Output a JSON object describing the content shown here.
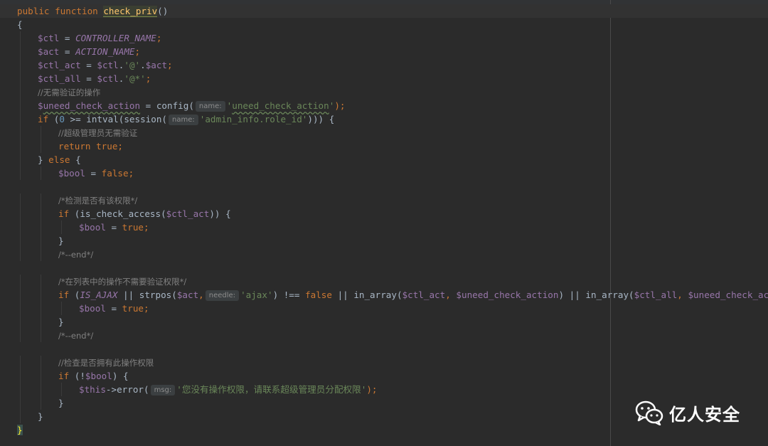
{
  "editor": {
    "lines": [
      {
        "indent": 0,
        "segs": [
          {
            "t": "public function ",
            "c": "kw"
          },
          {
            "t": "check_priv",
            "c": "fn-hl"
          },
          {
            "t": "()",
            "c": "plain"
          }
        ],
        "current": true
      },
      {
        "indent": 0,
        "segs": [
          {
            "t": "{",
            "c": "plain"
          }
        ]
      },
      {
        "indent": 1,
        "segs": [
          {
            "t": "$ctl",
            "c": "var"
          },
          {
            "t": " = ",
            "c": "plain"
          },
          {
            "t": "CONTROLLER_NAME",
            "c": "const"
          },
          {
            "t": ";",
            "c": "kw"
          }
        ]
      },
      {
        "indent": 1,
        "segs": [
          {
            "t": "$act",
            "c": "var"
          },
          {
            "t": " = ",
            "c": "plain"
          },
          {
            "t": "ACTION_NAME",
            "c": "const"
          },
          {
            "t": ";",
            "c": "kw"
          }
        ]
      },
      {
        "indent": 1,
        "segs": [
          {
            "t": "$ctl_act",
            "c": "var"
          },
          {
            "t": " = ",
            "c": "plain"
          },
          {
            "t": "$ctl",
            "c": "var"
          },
          {
            "t": ".",
            "c": "plain"
          },
          {
            "t": "'@'",
            "c": "str"
          },
          {
            "t": ".",
            "c": "plain"
          },
          {
            "t": "$act",
            "c": "var"
          },
          {
            "t": ";",
            "c": "kw"
          }
        ]
      },
      {
        "indent": 1,
        "segs": [
          {
            "t": "$ctl_all",
            "c": "var"
          },
          {
            "t": " = ",
            "c": "plain"
          },
          {
            "t": "$ctl",
            "c": "var"
          },
          {
            "t": ".",
            "c": "plain"
          },
          {
            "t": "'@*'",
            "c": "str"
          },
          {
            "t": ";",
            "c": "kw"
          }
        ]
      },
      {
        "indent": 1,
        "segs": [
          {
            "t": "//无需验证的操作",
            "c": "cmt"
          }
        ]
      },
      {
        "indent": 1,
        "segs": [
          {
            "t": "$",
            "c": "var"
          },
          {
            "t": "uneed_check_action",
            "c": "var wavy"
          },
          {
            "t": " = ",
            "c": "plain"
          },
          {
            "t": "config(",
            "c": "plain"
          },
          {
            "hint": "name:"
          },
          {
            "t": "'",
            "c": "str"
          },
          {
            "t": "uneed_check_action",
            "c": "str wavy"
          },
          {
            "t": "'",
            "c": "str"
          },
          {
            "t": ");",
            "c": "kw"
          }
        ]
      },
      {
        "indent": 1,
        "segs": [
          {
            "t": "if",
            "c": "kw"
          },
          {
            "t": " (",
            "c": "plain"
          },
          {
            "t": "0",
            "c": "num"
          },
          {
            "t": " >= intval(session(",
            "c": "plain"
          },
          {
            "hint": "name:"
          },
          {
            "t": "'admin_info.role_id'",
            "c": "str"
          },
          {
            "t": "))) {",
            "c": "plain"
          }
        ]
      },
      {
        "indent": 2,
        "segs": [
          {
            "t": "//超级管理员无需验证",
            "c": "cmt"
          }
        ]
      },
      {
        "indent": 2,
        "segs": [
          {
            "t": "return true",
            "c": "kw"
          },
          {
            "t": ";",
            "c": "kw"
          }
        ]
      },
      {
        "indent": 1,
        "segs": [
          {
            "t": "} ",
            "c": "plain"
          },
          {
            "t": "else",
            "c": "kw"
          },
          {
            "t": " {",
            "c": "plain"
          }
        ]
      },
      {
        "indent": 2,
        "segs": [
          {
            "t": "$bool",
            "c": "var"
          },
          {
            "t": " = ",
            "c": "plain"
          },
          {
            "t": "false",
            "c": "kw"
          },
          {
            "t": ";",
            "c": "kw"
          }
        ]
      },
      {
        "indent": 0,
        "segs": []
      },
      {
        "indent": 2,
        "segs": [
          {
            "t": "/*检测是否有该权限*/",
            "c": "cmt"
          }
        ]
      },
      {
        "indent": 2,
        "segs": [
          {
            "t": "if",
            "c": "kw"
          },
          {
            "t": " (is_check_access(",
            "c": "plain"
          },
          {
            "t": "$ctl_act",
            "c": "var"
          },
          {
            "t": ")) {",
            "c": "plain"
          }
        ]
      },
      {
        "indent": 3,
        "segs": [
          {
            "t": "$bool",
            "c": "var"
          },
          {
            "t": " = ",
            "c": "plain"
          },
          {
            "t": "true",
            "c": "kw"
          },
          {
            "t": ";",
            "c": "kw"
          }
        ]
      },
      {
        "indent": 2,
        "segs": [
          {
            "t": "}",
            "c": "plain"
          }
        ]
      },
      {
        "indent": 2,
        "segs": [
          {
            "t": "/*--end*/",
            "c": "cmt"
          }
        ]
      },
      {
        "indent": 0,
        "segs": []
      },
      {
        "indent": 2,
        "segs": [
          {
            "t": "/*在列表中的操作不需要验证权限*/",
            "c": "cmt"
          }
        ]
      },
      {
        "indent": 2,
        "segs": [
          {
            "t": "if",
            "c": "kw"
          },
          {
            "t": " (",
            "c": "plain"
          },
          {
            "t": "IS_AJAX",
            "c": "const"
          },
          {
            "t": " || strpos(",
            "c": "plain"
          },
          {
            "t": "$act",
            "c": "var"
          },
          {
            "t": ",",
            "c": "kw"
          },
          {
            "hint": "needle:"
          },
          {
            "t": "'ajax'",
            "c": "str"
          },
          {
            "t": ") !== ",
            "c": "plain"
          },
          {
            "t": "false",
            "c": "kw"
          },
          {
            "t": " || in_array(",
            "c": "plain"
          },
          {
            "t": "$ctl_act",
            "c": "var"
          },
          {
            "t": ", ",
            "c": "kw"
          },
          {
            "t": "$uneed_check_action",
            "c": "var"
          },
          {
            "t": ") || in_array(",
            "c": "plain"
          },
          {
            "t": "$ctl_all",
            "c": "var"
          },
          {
            "t": ", ",
            "c": "kw"
          },
          {
            "t": "$uneed_check_action",
            "c": "var"
          },
          {
            "t": "))",
            "c": "plain"
          }
        ]
      },
      {
        "indent": 3,
        "segs": [
          {
            "t": "$bool",
            "c": "var"
          },
          {
            "t": " = ",
            "c": "plain"
          },
          {
            "t": "true",
            "c": "kw"
          },
          {
            "t": ";",
            "c": "kw"
          }
        ]
      },
      {
        "indent": 2,
        "segs": [
          {
            "t": "}",
            "c": "plain"
          }
        ]
      },
      {
        "indent": 2,
        "segs": [
          {
            "t": "/*--end*/",
            "c": "cmt"
          }
        ]
      },
      {
        "indent": 0,
        "segs": []
      },
      {
        "indent": 2,
        "segs": [
          {
            "t": "//检查是否拥有此操作权限",
            "c": "cmt"
          }
        ]
      },
      {
        "indent": 2,
        "segs": [
          {
            "t": "if",
            "c": "kw"
          },
          {
            "t": " (!",
            "c": "plain"
          },
          {
            "t": "$bool",
            "c": "var"
          },
          {
            "t": ") {",
            "c": "plain"
          }
        ]
      },
      {
        "indent": 3,
        "segs": [
          {
            "t": "$this",
            "c": "var"
          },
          {
            "t": "->",
            "c": "plain"
          },
          {
            "t": "error(",
            "c": "plain"
          },
          {
            "hint": "msg:"
          },
          {
            "t": "'您没有操作权限，请联系超级管理员分配权限'",
            "c": "str"
          },
          {
            "t": ");",
            "c": "kw"
          }
        ]
      },
      {
        "indent": 2,
        "segs": [
          {
            "t": "}",
            "c": "plain"
          }
        ]
      },
      {
        "indent": 1,
        "segs": [
          {
            "t": "}",
            "c": "plain"
          }
        ]
      },
      {
        "indent": 0,
        "segs": [
          {
            "t": "}",
            "c": "brace-hl"
          }
        ]
      }
    ]
  },
  "watermark": {
    "text": "亿人安全",
    "icon": "wechat-icon"
  },
  "colors": {
    "background": "#2b2b2b",
    "keyword": "#cc7832",
    "function": "#ffc66d",
    "variable": "#9876aa",
    "string": "#6a8759",
    "number": "#6897bb",
    "comment": "#808080"
  }
}
